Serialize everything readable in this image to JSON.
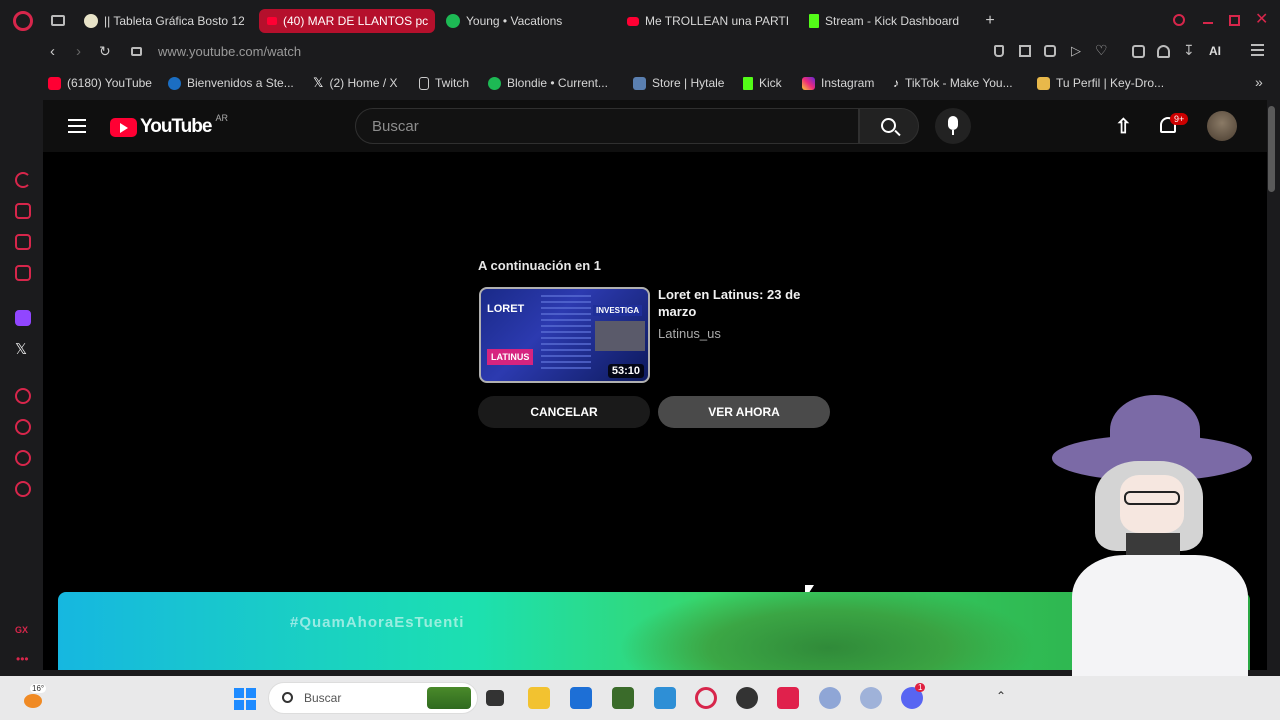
{
  "browser": {
    "tabs": [
      {
        "label": "|| Tableta Gráfica Bosto 12",
        "color": "#e8e3c8",
        "active": false
      },
      {
        "label": "(40) MAR DE LLANTOS pc",
        "color": "#ff0033",
        "active": true
      },
      {
        "label": "Young • Vacations",
        "color": "#1db954",
        "active": false
      },
      {
        "label": "Me TROLLEAN una PARTI",
        "color": "#ff0033",
        "active": false
      },
      {
        "label": "Stream - Kick Dashboard",
        "color": "#53fc18",
        "active": false
      }
    ],
    "url": "www.youtube.com/watch",
    "ai_label": "AI",
    "bookmarks": [
      {
        "label": "(6180) YouTube",
        "color": "#ff0033"
      },
      {
        "label": "Bienvenidos a Ste...",
        "color": "#1b6ec2"
      },
      {
        "label": "(2) Home / X",
        "color": "#ffffff"
      },
      {
        "label": "Twitch",
        "color": "#cccccc"
      },
      {
        "label": "Blondie • Current...",
        "color": "#1db954"
      },
      {
        "label": "Store | Hytale",
        "color": "#5a7fb0"
      },
      {
        "label": "Kick",
        "color": "#53fc18"
      },
      {
        "label": "Instagram",
        "color": "#d62976"
      },
      {
        "label": "TikTok - Make You...",
        "color": "#ffffff"
      },
      {
        "label": "Tu Perfil | Key-Dro...",
        "color": "#e8b84a"
      }
    ]
  },
  "youtube": {
    "logo_text": "YouTube",
    "region": "AR",
    "search_placeholder": "Buscar",
    "notif_badge": "9+",
    "up_next_label": "A continuación en 1",
    "video": {
      "title": "Loret en Latinus: 23 de marzo",
      "channel": "Latinus_us",
      "duration": "53:10",
      "thumb_brand": "LORET",
      "thumb_tag": "INVESTIGA",
      "thumb_network": "LATINUS"
    },
    "cancel_label": "CANCELAR",
    "watch_now_label": "VER AHORA",
    "banner_text": "#QuamAhoraEsTuenti"
  },
  "opera_sidebar": {
    "bottom_label": "GX"
  },
  "taskbar": {
    "weather_temp": "16°",
    "search_placeholder": "Buscar",
    "discord_badge": "1"
  },
  "colors": {
    "accent": "#d7264b",
    "youtube_red": "#ff0033",
    "active_tab": "#b5102c"
  }
}
